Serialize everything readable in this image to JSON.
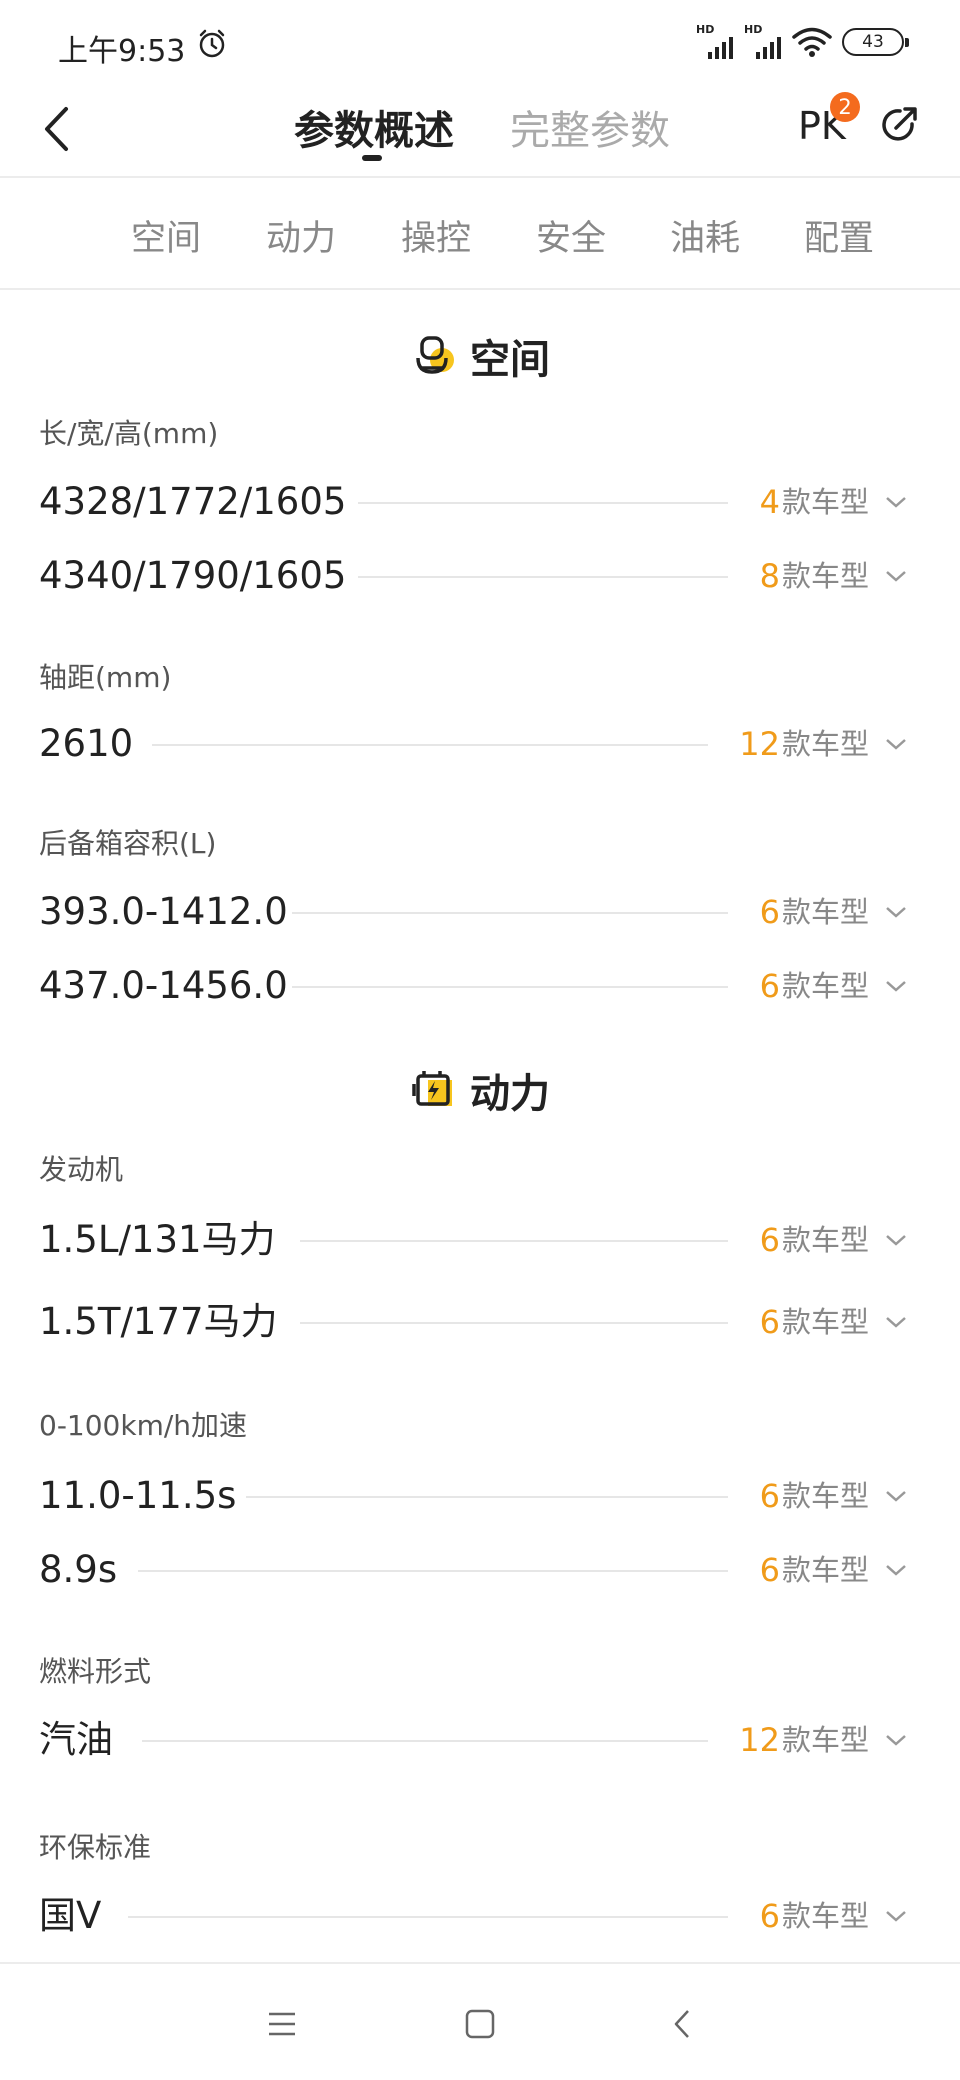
{
  "status": {
    "time": "上午9:53",
    "signal_label": "HD",
    "battery": "43"
  },
  "header": {
    "tabs": [
      "参数概述",
      "完整参数"
    ],
    "pk_label": "PK",
    "pk_badge": "2"
  },
  "categories": [
    "空间",
    "动力",
    "操控",
    "安全",
    "油耗",
    "配置"
  ],
  "unit_text": "款车型",
  "sections": [
    {
      "title": "空间",
      "icon": "seat-icon",
      "groups": [
        {
          "label": "长/宽/高(mm)",
          "rows": [
            {
              "value": "4328/1772/1605",
              "count": "4"
            },
            {
              "value": "4340/1790/1605",
              "count": "8"
            }
          ]
        },
        {
          "label": "轴距(mm)",
          "rows": [
            {
              "value": "2610",
              "count": "12"
            }
          ]
        },
        {
          "label": "后备箱容积(L)",
          "rows": [
            {
              "value": "393.0-1412.0",
              "count": "6"
            },
            {
              "value": "437.0-1456.0",
              "count": "6"
            }
          ]
        }
      ]
    },
    {
      "title": "动力",
      "icon": "battery-engine-icon",
      "groups": [
        {
          "label": "发动机",
          "rows": [
            {
              "value": "1.5L/131马力",
              "count": "6"
            },
            {
              "value": "1.5T/177马力",
              "count": "6"
            }
          ]
        },
        {
          "label": "0-100km/h加速",
          "rows": [
            {
              "value": "11.0-11.5s",
              "count": "6"
            },
            {
              "value": "8.9s",
              "count": "6"
            }
          ]
        },
        {
          "label": "燃料形式",
          "rows": [
            {
              "value": "汽油",
              "count": "12"
            }
          ]
        },
        {
          "label": "环保标准",
          "rows": [
            {
              "value": "国V",
              "count": "6"
            }
          ]
        }
      ]
    }
  ],
  "colors": {
    "accent_orange": "#f09b1a",
    "badge_orange": "#f46b1e",
    "icon_yellow": "#f7c51e"
  }
}
